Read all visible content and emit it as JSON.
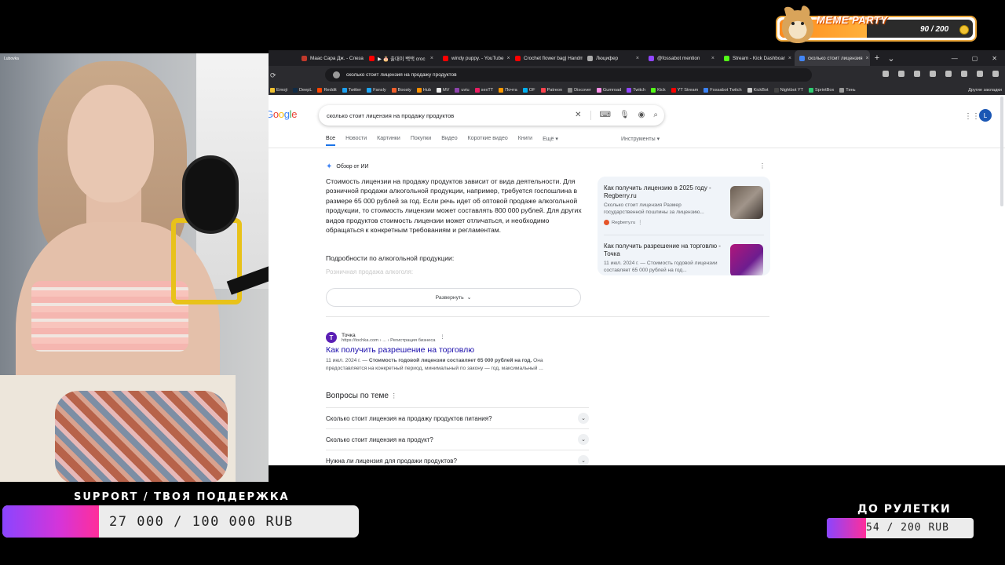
{
  "webcam": {
    "tag": "Lubovka"
  },
  "browser": {
    "tabs": [
      {
        "label": "Маас Сара Дж. - Слеза",
        "color": "#c0392b"
      },
      {
        "label": "▶ 🎂 출대이 백택 croc",
        "color": "#ff0000"
      },
      {
        "label": "windy puppy. - YouTube",
        "color": "#ff0000"
      },
      {
        "label": "Crochet flower bag| Handma",
        "color": "#ff0000"
      },
      {
        "label": "Люцифер",
        "color": "#aaaaaa"
      },
      {
        "label": "@fossabot mention",
        "color": "#9146ff"
      },
      {
        "label": "Stream - Kick Dashboar",
        "color": "#53fc18"
      },
      {
        "label": "сколько стоит лицензия",
        "color": "#4285f4"
      }
    ],
    "url": "сколько стоит лицензия на продажу продуктов",
    "bookmarks": [
      {
        "label": "Emoji",
        "color": "#f1c232"
      },
      {
        "label": "DeepL",
        "color": "#0f2b46"
      },
      {
        "label": "Reddit",
        "color": "#ff4500"
      },
      {
        "label": "Twitter",
        "color": "#1da1f2"
      },
      {
        "label": "Fansly",
        "color": "#1fa7f8"
      },
      {
        "label": "Boosty",
        "color": "#f15f2c"
      },
      {
        "label": "Hub",
        "color": "#ff9000"
      },
      {
        "label": "MV",
        "color": "#eeeeee"
      },
      {
        "label": "uviu",
        "color": "#8e44ad"
      },
      {
        "label": "sexTT",
        "color": "#e91e63"
      },
      {
        "label": "Почта",
        "color": "#ff9900"
      },
      {
        "label": "OF",
        "color": "#00aff0"
      },
      {
        "label": "Patreon",
        "color": "#ff424d"
      },
      {
        "label": "Discover",
        "color": "#888888"
      },
      {
        "label": "Gumroad",
        "color": "#ff90e8"
      },
      {
        "label": "Twitch",
        "color": "#9146ff"
      },
      {
        "label": "Kick",
        "color": "#53fc18"
      },
      {
        "label": "YT Stream",
        "color": "#ff0000"
      },
      {
        "label": "Fossabot Twitch",
        "color": "#3b82f6"
      },
      {
        "label": "KickBot",
        "color": "#cccccc"
      },
      {
        "label": "Nightbot YT",
        "color": "#444444"
      },
      {
        "label": "SprintBox",
        "color": "#2ecc71"
      },
      {
        "label": "Тинь",
        "color": "#999999"
      }
    ],
    "other_bookmarks": "Другие закладки"
  },
  "google": {
    "logo": "Google",
    "query": "сколько стоит лицензия на продажу продуктов",
    "avatar": "L",
    "tabs": [
      "Все",
      "Новости",
      "Картинки",
      "Покупки",
      "Видео",
      "Короткие видео",
      "Книги",
      "Ещё ▾"
    ],
    "tools": "Инструменты ▾",
    "ai_overview_label": "Обзор от ИИ",
    "ai_text": "Стоимость лицензии на продажу продуктов зависит от вида деятельности. Для розничной продажи алкогольной продукции, например, требуется госпошлина в размере 65 000 рублей за год. Если речь идет об оптовой продаже алкогольной продукции, то стоимость лицензии может составлять 800 000 рублей. Для других видов продуктов стоимость лицензии может отличаться, и необходимо обращаться к конкретным требованиям и регламентам.",
    "ai_subheading": "Подробности по алкогольной продукции:",
    "ai_faded": "Розничная продажа алкоголя:",
    "expand_label": "Развернуть",
    "cards": [
      {
        "title": "Как получить лицензию в 2025 году - Regberry.ru",
        "desc": "Сколько стоит лицензия Размер государственной пошлины за лицензию...",
        "source": "Regberry.ru"
      },
      {
        "title": "Как получить разрешение на торговлю - Точка",
        "desc": "11 июл. 2024 г. — Стоимость годовой лицензии составляет 65 000 рублей на год..."
      }
    ],
    "result": {
      "site_name": "Точка",
      "url": "https://tochka.com › ... › Регистрация бизнеса",
      "title": "Как получить разрешение на торговлю",
      "snippet_date": "11 июл. 2024 г. — ",
      "snippet_bold": "Стоимость годовой лицензии составляет 65 000 рублей на год.",
      "snippet_rest": " Она предоставляется на конкретный период, минимальный по закону — год, максимальный ..."
    },
    "paa_heading": "Вопросы по теме",
    "paa": [
      "Сколько стоит лицензия на продажу продуктов питания?",
      "Сколько стоит лицензия на продукт?",
      "Нужна ли лицензия для продажи продуктов?"
    ]
  },
  "overlay": {
    "meme_title": "MEME PARTY",
    "meme_count": "90 / 200",
    "meme_progress": 0.45,
    "support_title": "SUPPORT / ТВОЯ ПОДДЕРЖКА",
    "support_value": "27 000 / 100 000 RUB",
    "support_progress": 0.27,
    "roulette_title": "ДО РУЛЕТКИ",
    "roulette_value": "54 / 200 RUB",
    "roulette_progress": 0.27
  }
}
